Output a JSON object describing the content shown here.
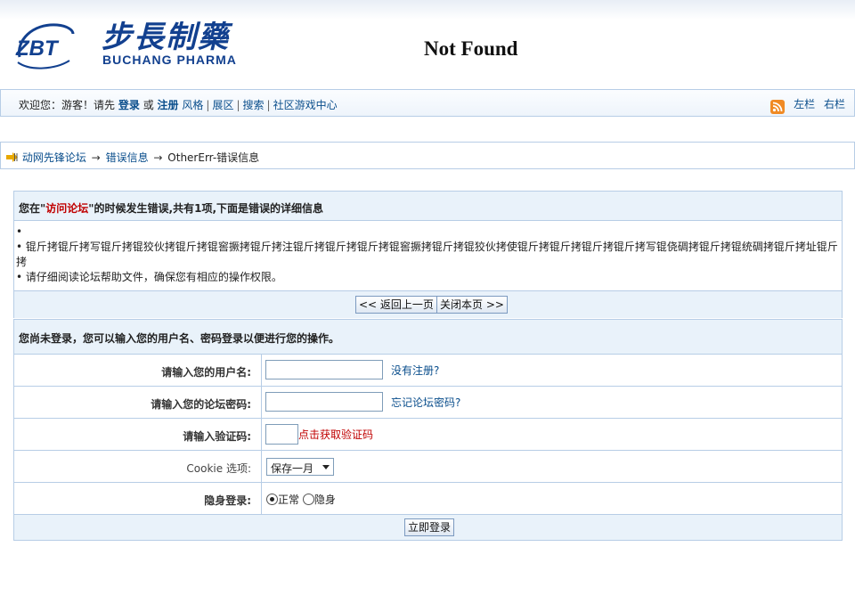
{
  "header": {
    "logo_mark_text": "ZBT",
    "logo_cn": "步長制藥",
    "logo_en": "BUCHANG PHARMA",
    "not_found": "Not Found"
  },
  "userbar": {
    "welcome": "欢迎您：游客！请先",
    "login": "登录",
    "or": "或",
    "register": "注册",
    "links": [
      "风格",
      "展区",
      "搜索",
      "社区游戏中心"
    ],
    "rss_icon": "rss-icon",
    "left_col": "左栏",
    "right_col": "右栏"
  },
  "breadcrumb": {
    "icon": "arrow-right-icon",
    "forum": "动网先锋论坛",
    "arrow": "→",
    "error_info": "错误信息",
    "current": "OtherErr-错误信息"
  },
  "error": {
    "title_prefix": "您在\"",
    "title_highlight": "访问论坛",
    "title_suffix": "\"的时候发生错误,共有1项,下面是错误的详细信息",
    "bullet": "•",
    "item1": "",
    "item2": "锟斤拷锟斤拷写锟斤拷锟狡伙拷锟斤拷锟窖撅拷锟斤拷注锟斤拷锟斤拷锟斤拷锟窖撅拷锟斤拷锟狡伙拷使锟斤拷锟斤拷锟斤拷锟斤拷写锟侥碉拷锟斤拷锟统碉拷锟斤拷址锟斤拷",
    "item3": "请仔细阅读论坛帮助文件，确保您有相应的操作权限。",
    "back_button": "<< 返回上一页",
    "close_button": "关闭本页 >>"
  },
  "login": {
    "title": "您尚未登录，您可以输入您的用户名、密码登录以便进行您的操作。",
    "username_label": "请输入您的用户名:",
    "username_value": "",
    "register_link": "没有注册?",
    "password_label": "请输入您的论坛密码:",
    "password_value": "",
    "forgot_link": "忘记论坛密码?",
    "captcha_label": "请输入验证码:",
    "captcha_value": "",
    "captcha_link": "点击获取验证码",
    "cookie_label": "Cookie 选项:",
    "cookie_selected": "保存一月",
    "hidden_label": "隐身登录:",
    "radio_normal": "正常",
    "radio_hidden": "隐身",
    "submit": "立即登录"
  },
  "colors": {
    "link": "#0a4e8c",
    "border": "#b7cde6",
    "panel_bg": "#e9f2fa",
    "logo_blue": "#12408f",
    "error_red": "#c00000"
  }
}
